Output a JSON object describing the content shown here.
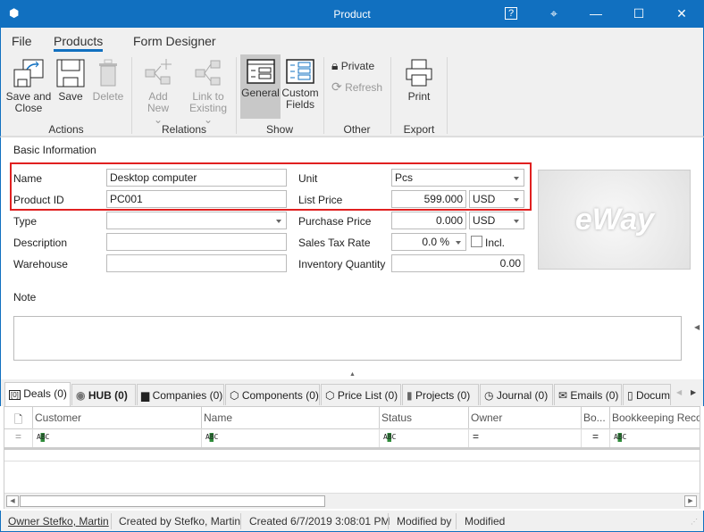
{
  "window": {
    "title": "Product",
    "help": "?",
    "pin": "⌖",
    "minimize": "—",
    "maximize": "☐",
    "close": "✕"
  },
  "menu": {
    "tabs": [
      "File",
      "Products",
      "Form Designer"
    ],
    "active": "Products"
  },
  "ribbon": {
    "groups": [
      {
        "label": "Actions",
        "buttons": [
          {
            "label": "Save and Close",
            "enabled": true
          },
          {
            "label": "Save",
            "enabled": true
          },
          {
            "label": "Delete",
            "enabled": false
          }
        ]
      },
      {
        "label": "Relations",
        "buttons": [
          {
            "label": "Add New",
            "enabled": false
          },
          {
            "label": "Link to Existing",
            "enabled": false
          }
        ]
      },
      {
        "label": "Show",
        "buttons": [
          {
            "label": "General",
            "selected": true
          },
          {
            "label": "Custom Fields"
          }
        ]
      },
      {
        "label": "Other",
        "buttons": [
          {
            "label": "Private",
            "enabled": true
          },
          {
            "label": "Refresh",
            "enabled": false
          }
        ]
      },
      {
        "label": "Export",
        "buttons": [
          {
            "label": "Print",
            "enabled": true
          }
        ]
      }
    ],
    "save_and_close_l1": "Save and",
    "save_and_close_l2": "Close",
    "add_new": "Add New",
    "link_l1": "Link to",
    "link_l2": "Existing",
    "custom_l1": "Custom",
    "custom_l2": "Fields"
  },
  "form": {
    "section": "Basic Information",
    "name_label": "Name",
    "name_value": "Desktop computer",
    "product_id_label": "Product ID",
    "product_id_value": "PC001",
    "type_label": "Type",
    "type_value": "",
    "description_label": "Description",
    "description_value": "",
    "warehouse_label": "Warehouse",
    "warehouse_value": "",
    "unit_label": "Unit",
    "unit_value": "Pcs",
    "list_price_label": "List Price",
    "list_price_value": "599.000",
    "list_price_currency": "USD",
    "purchase_price_label": "Purchase Price",
    "purchase_price_value": "0.000",
    "purchase_price_currency": "USD",
    "sales_tax_label": "Sales Tax Rate",
    "sales_tax_value": "0.0 %",
    "incl_label": "Incl.",
    "incl_checked": false,
    "inventory_label": "Inventory Quantity",
    "inventory_value": "0.00",
    "note_label": "Note",
    "note_value": "",
    "logo": "eWay CRM",
    "highlight_color": "#e02020"
  },
  "tabs": [
    "Deals (0)",
    "HUB (0)",
    "Companies (0)",
    "Components (0)",
    "Price List (0)",
    "Projects (0)",
    "Journal (0)",
    "Emails (0)",
    "Docum"
  ],
  "grid": {
    "columns": [
      "",
      "Customer",
      "Name",
      "Status",
      "Owner",
      "Bo...",
      "Bookkeeping Record"
    ],
    "filter_abc": "ABC",
    "filter_eq": "="
  },
  "status": {
    "owner": "Owner Stefko, Martin",
    "created_by": "Created by Stefko, Martin",
    "created": "Created 6/7/2019 3:08:01 PM",
    "modified_by": "Modified by",
    "modified": "Modified"
  },
  "colors": {
    "titlebar": "#1170c0",
    "accent": "#1170c0"
  }
}
